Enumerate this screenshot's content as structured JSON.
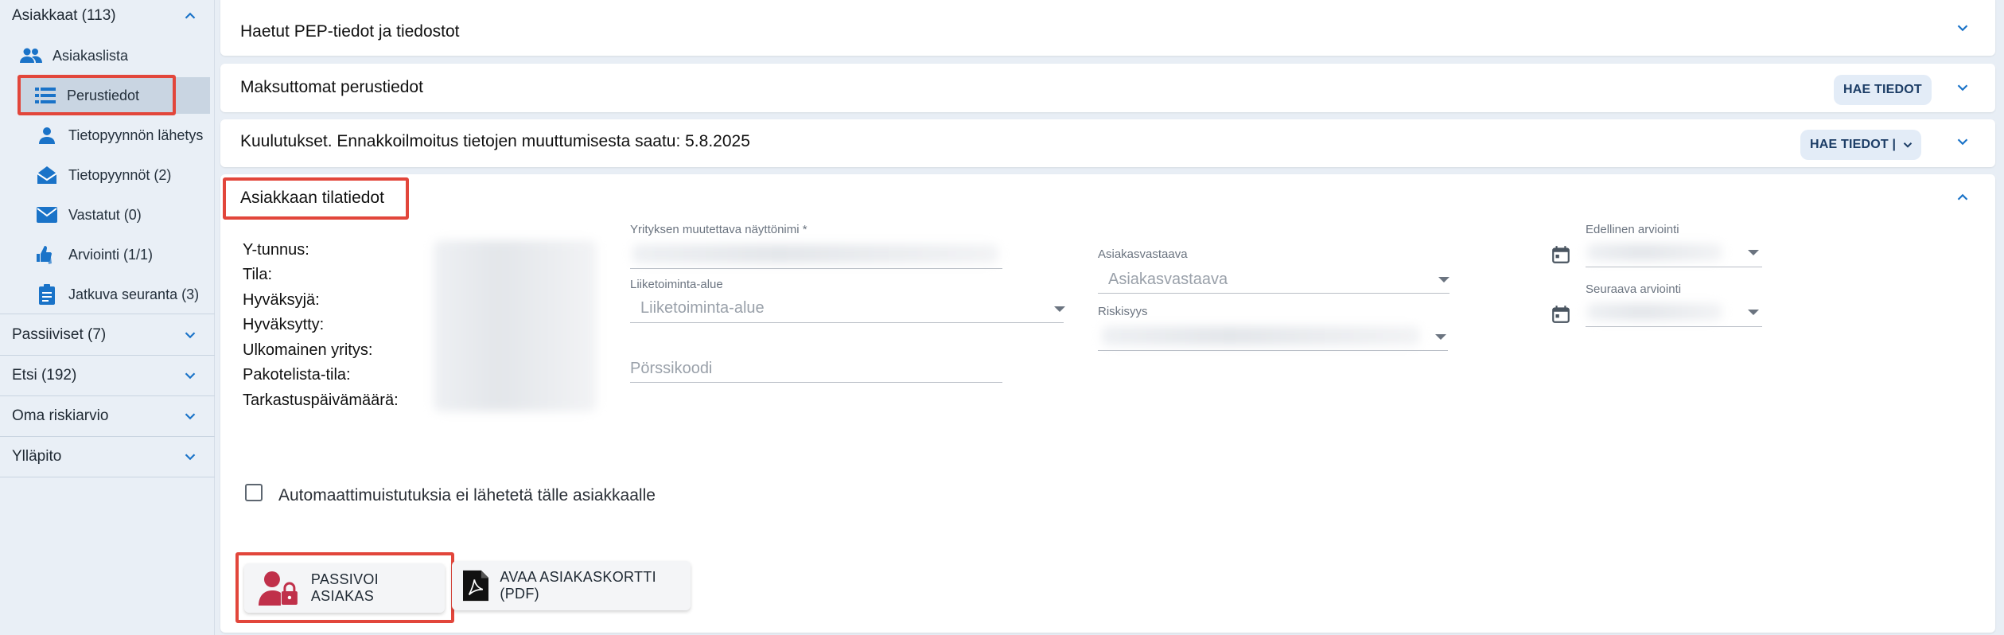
{
  "sidebar": {
    "sections": {
      "asiakkaat": "Asiakkaat (113)",
      "passiiviset": "Passiiviset (7)",
      "etsi": "Etsi (192)",
      "oma_riskiarvio": "Oma riskiarvio",
      "yllapito": "Ylläpito"
    },
    "items": [
      {
        "label": "Asiakaslista",
        "icon": "people-icon"
      },
      {
        "label": "Perustiedot",
        "icon": "list-icon"
      },
      {
        "label": "Tietopyynnön lähetys",
        "icon": "person-icon"
      },
      {
        "label": "Tietopyynnöt (2)",
        "icon": "envelope-open-icon"
      },
      {
        "label": "Vastatut (0)",
        "icon": "envelope-icon"
      },
      {
        "label": "Arviointi (1/1)",
        "icon": "thumbs-icon"
      },
      {
        "label": "Jatkuva seuranta (3)",
        "icon": "clipboard-icon"
      }
    ]
  },
  "cards": {
    "pep": {
      "title": "Haetut PEP-tiedot ja tiedostot"
    },
    "maksuttomat": {
      "title": "Maksuttomat perustiedot",
      "button": "HAE TIEDOT"
    },
    "kuulutukset": {
      "title": "Kuulutukset. Ennakkoilmoitus tietojen muuttumisesta saatu: 5.8.2025",
      "button": "HAE TIEDOT |"
    },
    "tilatiedot": {
      "title": "Asiakkaan tilatiedot"
    }
  },
  "info_labels": [
    "Y-tunnus:",
    "Tila:",
    "Hyväksyjä:",
    "Hyväksytty:",
    "Ulkomainen yritys:",
    "Pakotelista-tila:",
    "Tarkastuspäivämäärä:"
  ],
  "form": {
    "nayttonimi_label": "Yrityksen muutettava näyttönimi *",
    "liiketoiminta_label": "Liiketoiminta-alue",
    "liiketoiminta_placeholder": "Liiketoiminta-alue",
    "porssikoodi_placeholder": "Pörssikoodi",
    "asiakasvastaava_label": "Asiakasvastaava",
    "asiakasvastaava_placeholder": "Asiakasvastaava",
    "riskisyys_label": "Riskisyys",
    "edellinen_label": "Edellinen arviointi",
    "seuraava_label": "Seuraava arviointi"
  },
  "checkbox_label": "Automaattimuistutuksia ei lähetetä tälle asiakkaalle",
  "buttons": {
    "passivoi": "PASSIVOI ASIAKAS",
    "avaa": "AVAA ASIAKASKORTTI (PDF)"
  },
  "colors": {
    "accent": "#1a73c8",
    "highlight": "#e2463b",
    "danger": "#c0304a"
  }
}
